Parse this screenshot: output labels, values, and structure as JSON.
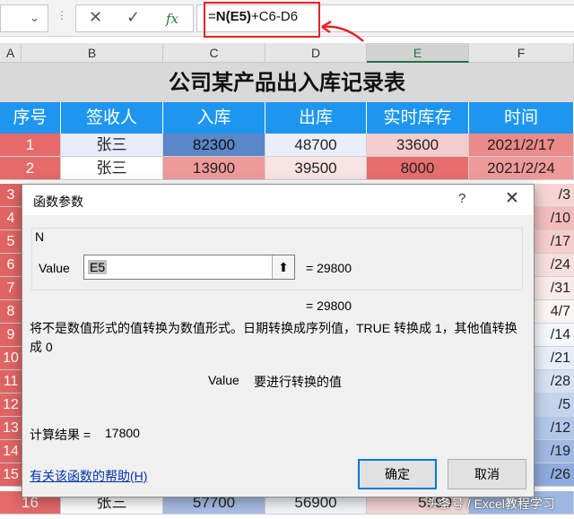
{
  "formula_bar": {
    "name_box_dropdown": "⌄",
    "cancel_icon": "✕",
    "enter_icon": "✓",
    "fx_label": "fx",
    "formula_prefix": "=",
    "formula_func": "N(E5)",
    "formula_rest": "+C6-D6"
  },
  "columns": [
    "A",
    "B",
    "C",
    "D",
    "E",
    "F"
  ],
  "sheet": {
    "title": "公司某产品出入库记录表",
    "headers": [
      "序号",
      "签收人",
      "入库",
      "出库",
      "实时库存",
      "时间"
    ],
    "rows": [
      {
        "no": "1",
        "name": "张三",
        "in": "82300",
        "out": "48700",
        "stock": "33600",
        "date": "2021/2/17"
      },
      {
        "no": "2",
        "name": "张三",
        "in": "13900",
        "out": "39500",
        "stock": "8000",
        "date": "2021/2/24"
      },
      {
        "no": "16",
        "name": "张三",
        "in": "57700",
        "out": "56900",
        "stock": "5990",
        "date": ""
      }
    ],
    "left_row_numbers": [
      "3",
      "4",
      "5",
      "6",
      "7",
      "8",
      "9",
      "10",
      "11",
      "12",
      "13",
      "14",
      "15"
    ],
    "right_partial_dates": [
      "/3",
      "/10",
      "/17",
      "/24",
      "/31",
      "4/7",
      "/14",
      "/21",
      "/28",
      "/5",
      "/12",
      "/19",
      "/26"
    ]
  },
  "dialog": {
    "title": "函数参数",
    "help_icon": "?",
    "close_icon": "✕",
    "function_name": "N",
    "param_label": "Value",
    "param_value": "E5",
    "collapse_icon": "⬆",
    "param_eval": "=  29800",
    "formula_eval": "=  29800",
    "description": "将不是数值形式的值转换为数值形式。日期转换成序列值，TRUE 转换成 1，其他值转换成 0",
    "arg_name": "Value",
    "arg_description": "要进行转换的值",
    "result_label": "计算结果 =",
    "result_value": "17800",
    "help_link": "有关该函数的帮助(H)",
    "ok_label": "确定",
    "cancel_label": "取消"
  },
  "watermark": "头条号 / Excel教程学习",
  "colors": {
    "header_blue": "#1e96f0",
    "title_gray": "#d9d9d9",
    "row_head_red": "#e06464",
    "annotation_red": "#e0242a",
    "link_blue": "#0033aa"
  }
}
